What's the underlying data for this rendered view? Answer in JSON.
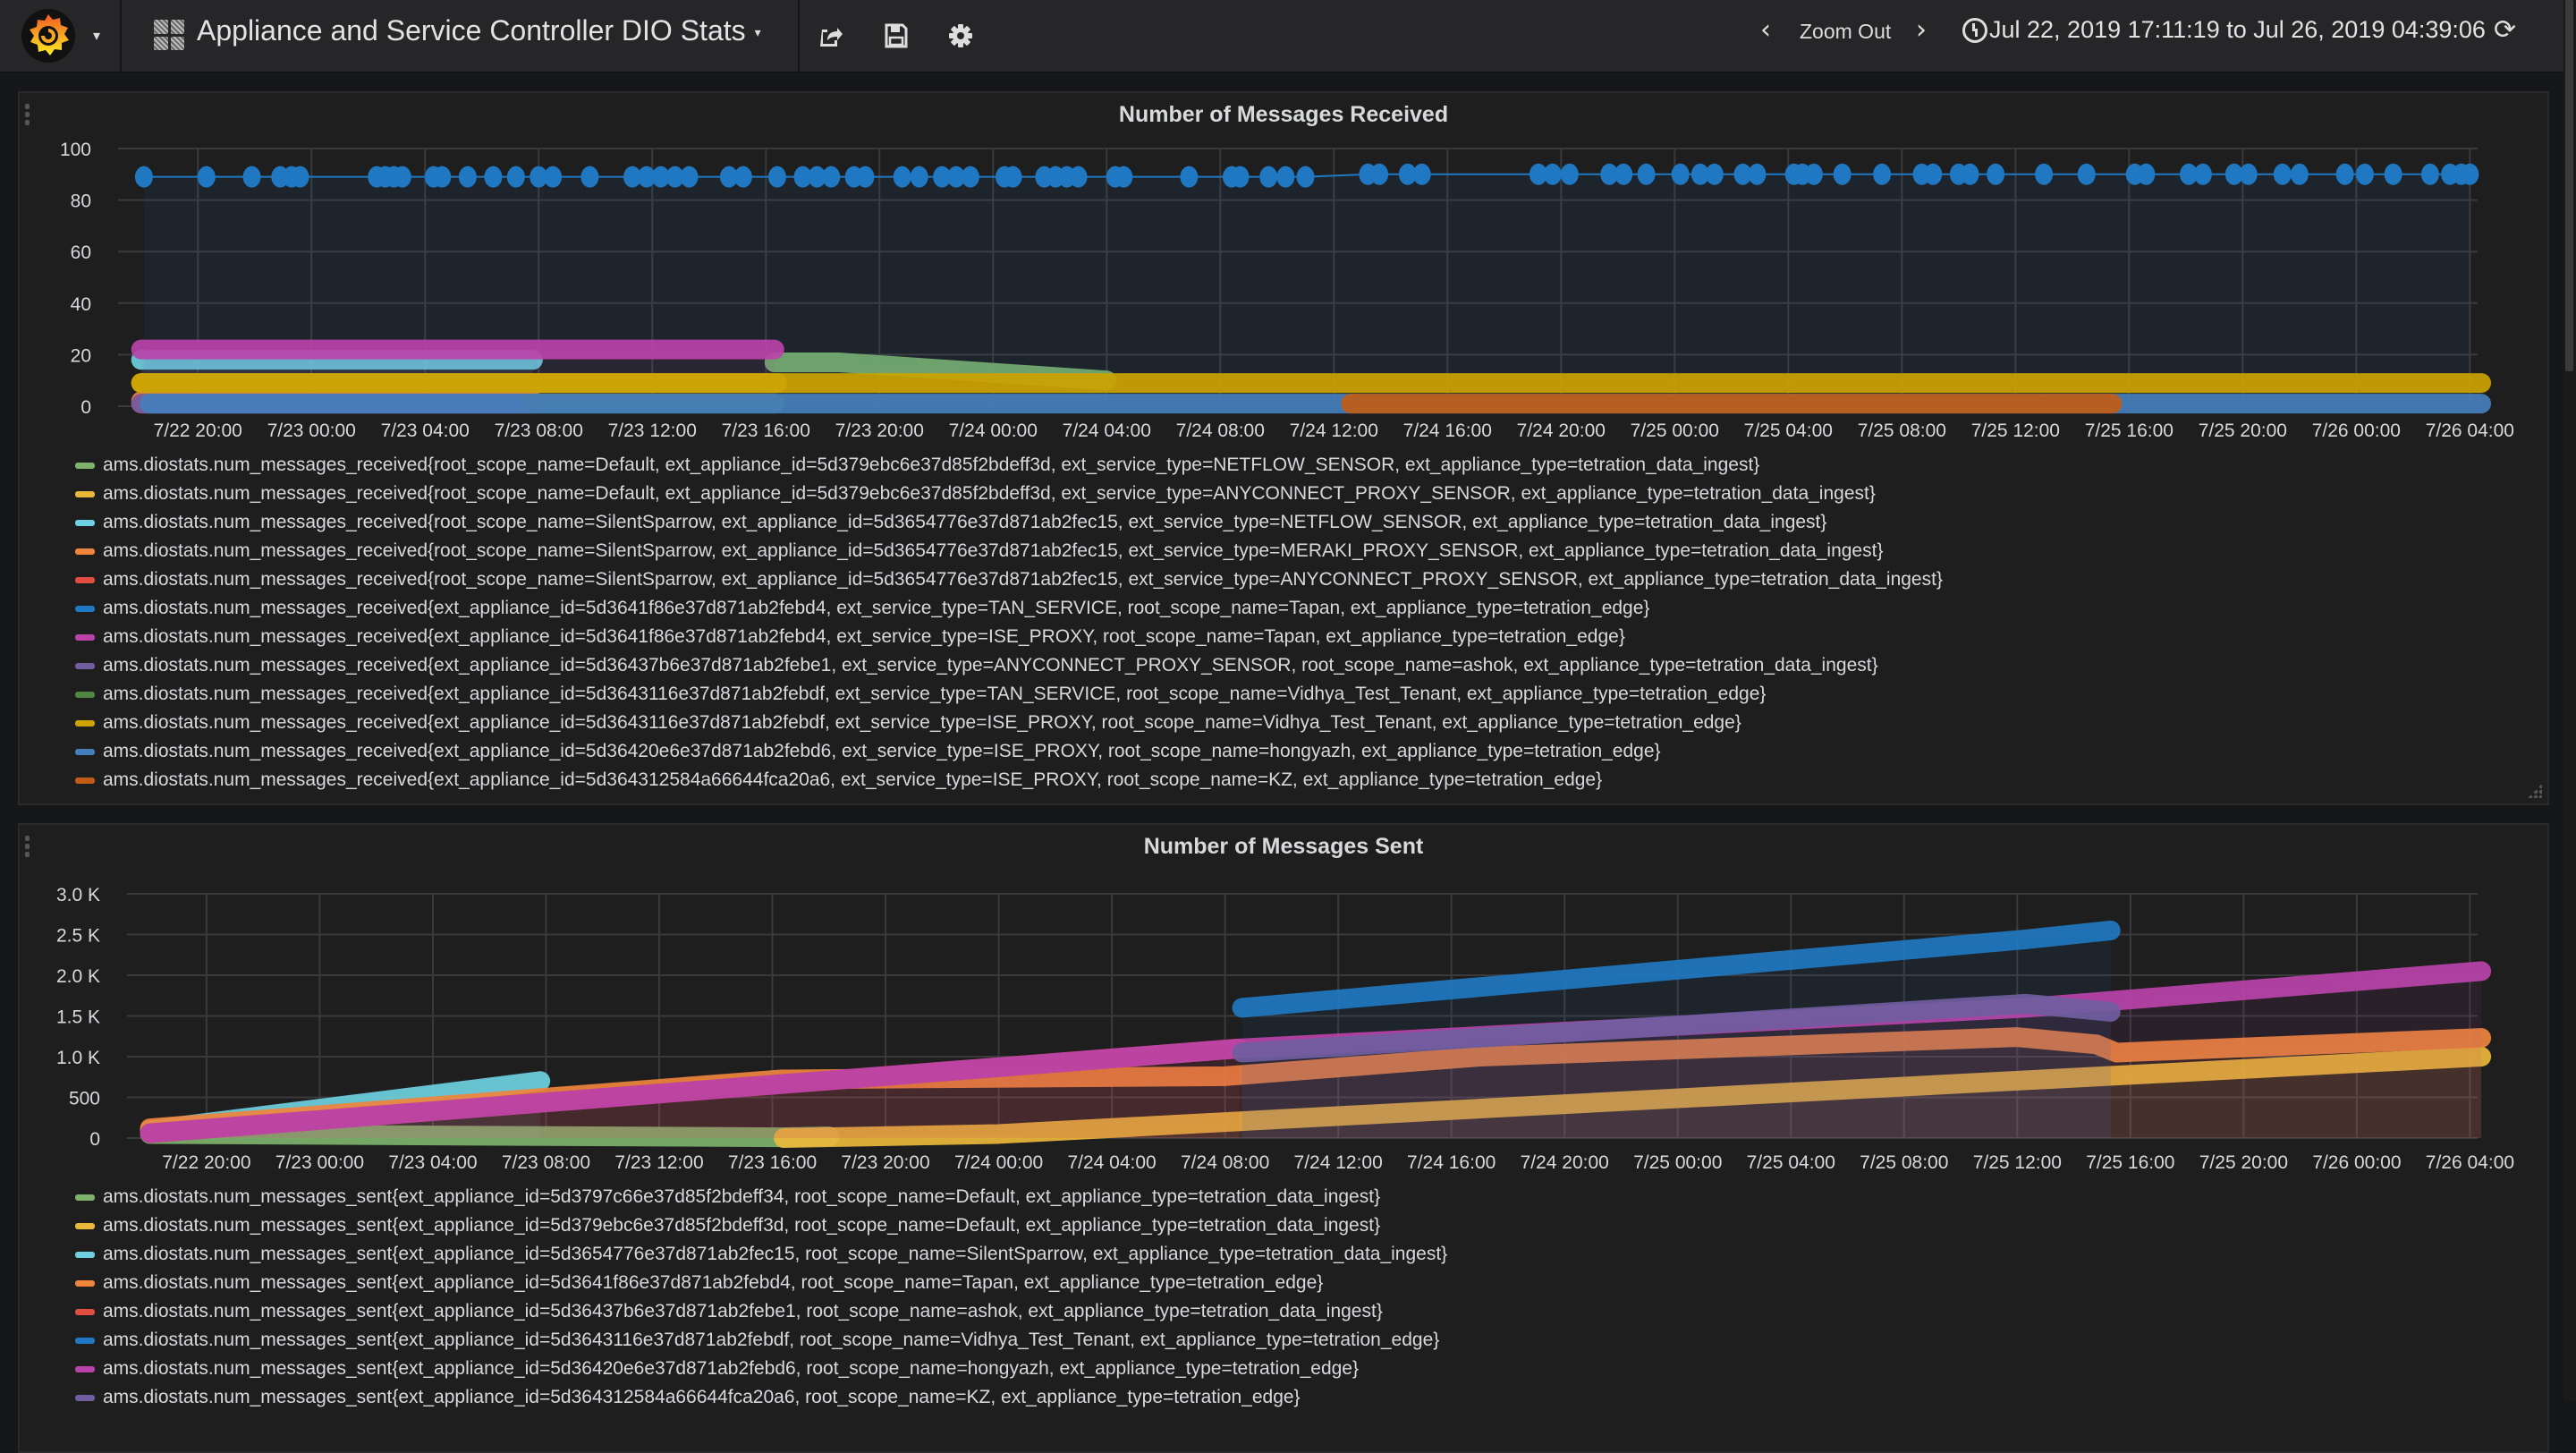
{
  "navbar": {
    "logo_icon": "grafana-logo-icon",
    "dashboard_title": "Appliance and Service Controller DIO Stats",
    "share_icon": "share-icon",
    "save_icon": "save-icon",
    "settings_icon": "gear-icon",
    "zoom_out_label": "Zoom Out",
    "time_range": "Jul 22, 2019 17:11:19 to Jul 26, 2019 04:39:06",
    "refresh_icon": "refresh-icon"
  },
  "panels": [
    {
      "title": "Number of Messages Received",
      "legend": [
        {
          "color": "#7eb26d",
          "label": "ams.diostats.num_messages_received{root_scope_name=Default, ext_appliance_id=5d379ebc6e37d85f2bdeff3d, ext_service_type=NETFLOW_SENSOR, ext_appliance_type=tetration_data_ingest}"
        },
        {
          "color": "#eab839",
          "label": "ams.diostats.num_messages_received{root_scope_name=Default, ext_appliance_id=5d379ebc6e37d85f2bdeff3d, ext_service_type=ANYCONNECT_PROXY_SENSOR, ext_appliance_type=tetration_data_ingest}"
        },
        {
          "color": "#6ed0e0",
          "label": "ams.diostats.num_messages_received{root_scope_name=SilentSparrow, ext_appliance_id=5d3654776e37d871ab2fec15, ext_service_type=NETFLOW_SENSOR, ext_appliance_type=tetration_data_ingest}"
        },
        {
          "color": "#ef843c",
          "label": "ams.diostats.num_messages_received{root_scope_name=SilentSparrow, ext_appliance_id=5d3654776e37d871ab2fec15, ext_service_type=MERAKI_PROXY_SENSOR, ext_appliance_type=tetration_data_ingest}"
        },
        {
          "color": "#e24d42",
          "label": "ams.diostats.num_messages_received{root_scope_name=SilentSparrow, ext_appliance_id=5d3654776e37d871ab2fec15, ext_service_type=ANYCONNECT_PROXY_SENSOR, ext_appliance_type=tetration_data_ingest}"
        },
        {
          "color": "#1f78c1",
          "label": "ams.diostats.num_messages_received{ext_appliance_id=5d3641f86e37d871ab2febd4, ext_service_type=TAN_SERVICE, root_scope_name=Tapan, ext_appliance_type=tetration_edge}"
        },
        {
          "color": "#ba43a9",
          "label": "ams.diostats.num_messages_received{ext_appliance_id=5d3641f86e37d871ab2febd4, ext_service_type=ISE_PROXY, root_scope_name=Tapan, ext_appliance_type=tetration_edge}"
        },
        {
          "color": "#705da0",
          "label": "ams.diostats.num_messages_received{ext_appliance_id=5d36437b6e37d871ab2febe1, ext_service_type=ANYCONNECT_PROXY_SENSOR, root_scope_name=ashok, ext_appliance_type=tetration_data_ingest}"
        },
        {
          "color": "#508642",
          "label": "ams.diostats.num_messages_received{ext_appliance_id=5d3643116e37d871ab2febdf, ext_service_type=TAN_SERVICE, root_scope_name=Vidhya_Test_Tenant, ext_appliance_type=tetration_edge}"
        },
        {
          "color": "#cca300",
          "label": "ams.diostats.num_messages_received{ext_appliance_id=5d3643116e37d871ab2febdf, ext_service_type=ISE_PROXY, root_scope_name=Vidhya_Test_Tenant, ext_appliance_type=tetration_edge}"
        },
        {
          "color": "#447ebc",
          "label": "ams.diostats.num_messages_received{ext_appliance_id=5d36420e6e37d871ab2febd6, ext_service_type=ISE_PROXY, root_scope_name=hongyazh, ext_appliance_type=tetration_edge}"
        },
        {
          "color": "#c15c17",
          "label": "ams.diostats.num_messages_received{ext_appliance_id=5d364312584a66644fca20a6, ext_service_type=ISE_PROXY, root_scope_name=KZ, ext_appliance_type=tetration_edge}"
        }
      ]
    },
    {
      "title": "Number of Messages Sent",
      "legend": [
        {
          "color": "#7eb26d",
          "label": "ams.diostats.num_messages_sent{ext_appliance_id=5d3797c66e37d85f2bdeff34, root_scope_name=Default, ext_appliance_type=tetration_data_ingest}"
        },
        {
          "color": "#eab839",
          "label": "ams.diostats.num_messages_sent{ext_appliance_id=5d379ebc6e37d85f2bdeff3d, root_scope_name=Default, ext_appliance_type=tetration_data_ingest}"
        },
        {
          "color": "#6ed0e0",
          "label": "ams.diostats.num_messages_sent{ext_appliance_id=5d3654776e37d871ab2fec15, root_scope_name=SilentSparrow, ext_appliance_type=tetration_data_ingest}"
        },
        {
          "color": "#ef843c",
          "label": "ams.diostats.num_messages_sent{ext_appliance_id=5d3641f86e37d871ab2febd4, root_scope_name=Tapan, ext_appliance_type=tetration_edge}"
        },
        {
          "color": "#e24d42",
          "label": "ams.diostats.num_messages_sent{ext_appliance_id=5d36437b6e37d871ab2febe1, root_scope_name=ashok, ext_appliance_type=tetration_data_ingest}"
        },
        {
          "color": "#1f78c1",
          "label": "ams.diostats.num_messages_sent{ext_appliance_id=5d3643116e37d871ab2febdf, root_scope_name=Vidhya_Test_Tenant, ext_appliance_type=tetration_edge}"
        },
        {
          "color": "#ba43a9",
          "label": "ams.diostats.num_messages_sent{ext_appliance_id=5d36420e6e37d871ab2febd6, root_scope_name=hongyazh, ext_appliance_type=tetration_edge}"
        },
        {
          "color": "#705da0",
          "label": "ams.diostats.num_messages_sent{ext_appliance_id=5d364312584a66644fca20a6, root_scope_name=KZ, ext_appliance_type=tetration_edge}"
        }
      ]
    }
  ],
  "chart_data": [
    {
      "type": "line",
      "title": "Number of Messages Received",
      "xlabel": "",
      "ylabel": "",
      "x_ticks": [
        "7/22 20:00",
        "7/23 00:00",
        "7/23 04:00",
        "7/23 08:00",
        "7/23 12:00",
        "7/23 16:00",
        "7/23 20:00",
        "7/24 00:00",
        "7/24 04:00",
        "7/24 08:00",
        "7/24 12:00",
        "7/24 16:00",
        "7/24 20:00",
        "7/25 00:00",
        "7/25 04:00",
        "7/25 08:00",
        "7/25 12:00",
        "7/25 16:00",
        "7/25 20:00",
        "7/26 00:00",
        "7/26 04:00"
      ],
      "y_ticks": [
        "0",
        "20",
        "40",
        "60",
        "80",
        "100"
      ],
      "xlim_hours_from_7_22_00": [
        17.19,
        100.65
      ],
      "ylim": [
        0,
        100
      ],
      "grid": true,
      "legend_position": "bottom",
      "series": [
        {
          "name": "Default NETFLOW_SENSOR",
          "color": "#7eb26d",
          "x_hours": [
            40.3,
            42.6,
            52.0
          ],
          "y": [
            17,
            17,
            10
          ]
        },
        {
          "name": "Default ANYCONNECT_PROXY_SENSOR",
          "color": "#eab839",
          "x_hours": [
            18.0,
            40.4
          ],
          "y": [
            9,
            9
          ]
        },
        {
          "name": "SilentSparrow NETFLOW_SENSOR",
          "color": "#6ed0e0",
          "x_hours": [
            18.0,
            31.8
          ],
          "y": [
            18,
            18
          ]
        },
        {
          "name": "SilentSparrow MERAKI_PROXY_SENSOR",
          "color": "#ef843c",
          "x_hours": [
            18.0,
            31.8
          ],
          "y": [
            2,
            2
          ]
        },
        {
          "name": "SilentSparrow ANYCONNECT_PROXY_SENSOR",
          "color": "#e24d42",
          "x_hours": [
            18.0,
            31.8
          ],
          "y": [
            1,
            1
          ]
        },
        {
          "name": "Tapan TAN_SERVICE",
          "color": "#1f78c1",
          "x_hours": [
            18.1,
            20.3,
            21.9,
            22.9,
            23.3,
            23.6,
            26.3,
            26.6,
            26.9,
            27.2,
            28.3,
            28.6,
            29.5,
            30.4,
            31.2,
            32.0,
            32.5,
            33.8,
            35.3,
            35.8,
            36.3,
            36.8,
            37.3,
            38.7,
            39.2,
            40.4,
            41.3,
            41.8,
            42.3,
            43.1,
            43.5,
            44.8,
            45.4,
            46.2,
            46.7,
            47.2,
            48.4,
            48.7,
            49.8,
            50.2,
            50.6,
            51.0,
            52.3,
            52.6,
            54.9,
            56.4,
            56.7,
            57.7,
            58.3,
            59.0,
            61.2,
            61.6,
            62.6,
            63.1,
            67.2,
            67.7,
            68.3,
            69.7,
            70.2,
            71.0,
            72.2,
            72.9,
            73.4,
            74.4,
            74.9,
            76.2,
            76.5,
            76.9,
            77.9,
            79.3,
            80.7,
            81.1,
            82.0,
            82.4,
            83.3,
            85.0,
            86.5,
            88.2,
            88.6,
            90.1,
            90.6,
            91.7,
            92.2,
            93.4,
            94.0,
            95.6,
            96.3,
            97.3,
            98.6,
            99.3,
            99.7,
            100.0
          ],
          "y": [
            89,
            89,
            89,
            89,
            89,
            89,
            89,
            89,
            89,
            89,
            89,
            89,
            89,
            89,
            89,
            89,
            89,
            89,
            89,
            89,
            89,
            89,
            89,
            89,
            89,
            89,
            89,
            89,
            89,
            89,
            89,
            89,
            89,
            89,
            89,
            89,
            89,
            89,
            89,
            89,
            89,
            89,
            89,
            89,
            89,
            89,
            89,
            89,
            89,
            89,
            90,
            90,
            90,
            90,
            90,
            90,
            90,
            90,
            90,
            90,
            90,
            90,
            90,
            90,
            90,
            90,
            90,
            90,
            90,
            90,
            90,
            90,
            90,
            90,
            90,
            90,
            90,
            90,
            90,
            90,
            90,
            90,
            90,
            90,
            90,
            90,
            90,
            90,
            90,
            90,
            90,
            90
          ]
        },
        {
          "name": "Tapan ISE_PROXY",
          "color": "#ba43a9",
          "x_hours": [
            18.0,
            40.3
          ],
          "y": [
            22,
            22
          ]
        },
        {
          "name": "ashok ANYCONNECT_PROXY_SENSOR",
          "color": "#705da0",
          "x_hours": [
            18.0,
            31.8
          ],
          "y": [
            1,
            1
          ]
        },
        {
          "name": "Vidhya_Test_Tenant TAN_SERVICE",
          "color": "#508642",
          "x_hours": [
            31.8,
            40.3
          ],
          "y": [
            1,
            1
          ]
        },
        {
          "name": "Vidhya_Test_Tenant ISE_PROXY",
          "color": "#cca300",
          "x_hours": [
            18.0,
            40.4,
            43.0,
            100.4
          ],
          "y": [
            9,
            9,
            9,
            9
          ]
        },
        {
          "name": "hongyazh ISE_PROXY",
          "color": "#447ebc",
          "x_hours": [
            18.3,
            20.1,
            21.9,
            23.4,
            29.1,
            31.0,
            31.8,
            100.4
          ],
          "y": [
            1,
            1,
            1,
            1,
            1,
            1,
            1,
            1
          ]
        },
        {
          "name": "KZ ISE_PROXY",
          "color": "#c15c17",
          "x_hours": [
            60.6,
            84.6,
            87.4
          ],
          "y": [
            1,
            1,
            1
          ]
        }
      ]
    },
    {
      "type": "line",
      "title": "Number of Messages Sent",
      "xlabel": "",
      "ylabel": "",
      "x_ticks": [
        "7/22 20:00",
        "7/23 00:00",
        "7/23 04:00",
        "7/23 08:00",
        "7/23 12:00",
        "7/23 16:00",
        "7/23 20:00",
        "7/24 00:00",
        "7/24 04:00",
        "7/24 08:00",
        "7/24 12:00",
        "7/24 16:00",
        "7/24 20:00",
        "7/25 00:00",
        "7/25 04:00",
        "7/25 08:00",
        "7/25 12:00",
        "7/25 16:00",
        "7/25 20:00",
        "7/26 00:00",
        "7/26 04:00"
      ],
      "y_ticks": [
        "0",
        "500",
        "1.0 K",
        "1.5 K",
        "2.0 K",
        "2.5 K",
        "3.0 K"
      ],
      "xlim_hours_from_7_22_00": [
        17.19,
        100.65
      ],
      "ylim": [
        0,
        3000
      ],
      "grid": true,
      "legend_position": "bottom",
      "series": [
        {
          "name": "Default 5d3797c6",
          "color": "#7eb26d",
          "x_hours": [
            18.0,
            40.3,
            42.0
          ],
          "y": [
            50,
            10,
            20
          ]
        },
        {
          "name": "Default 5d379ebc",
          "color": "#eab839",
          "x_hours": [
            40.4,
            48.0,
            66.0,
            100.4
          ],
          "y": [
            0,
            50,
            380,
            1000
          ]
        },
        {
          "name": "SilentSparrow",
          "color": "#6ed0e0",
          "x_hours": [
            18.0,
            31.8
          ],
          "y": [
            100,
            700
          ]
        },
        {
          "name": "Tapan",
          "color": "#ef843c",
          "x_hours": [
            18.0,
            40.3,
            56.0,
            65.0,
            84.0,
            86.8,
            87.5,
            100.4
          ],
          "y": [
            120,
            720,
            760,
            1000,
            1240,
            1150,
            1050,
            1230
          ]
        },
        {
          "name": "ashok",
          "color": "#e24d42",
          "x_hours": [
            18.0,
            56.5
          ],
          "y": [
            60,
            1100
          ]
        },
        {
          "name": "Vidhya_Test_Tenant",
          "color": "#1f78c1",
          "x_hours": [
            56.6,
            84.3,
            87.3
          ],
          "y": [
            1600,
            2440,
            2550
          ]
        },
        {
          "name": "hongyazh",
          "color": "#ba43a9",
          "x_hours": [
            18.0,
            56.5,
            84.3,
            100.4
          ],
          "y": [
            60,
            1100,
            1600,
            2050
          ]
        },
        {
          "name": "KZ",
          "color": "#705da0",
          "x_hours": [
            56.6,
            84.3,
            87.3
          ],
          "y": [
            1050,
            1650,
            1550
          ]
        }
      ]
    }
  ]
}
